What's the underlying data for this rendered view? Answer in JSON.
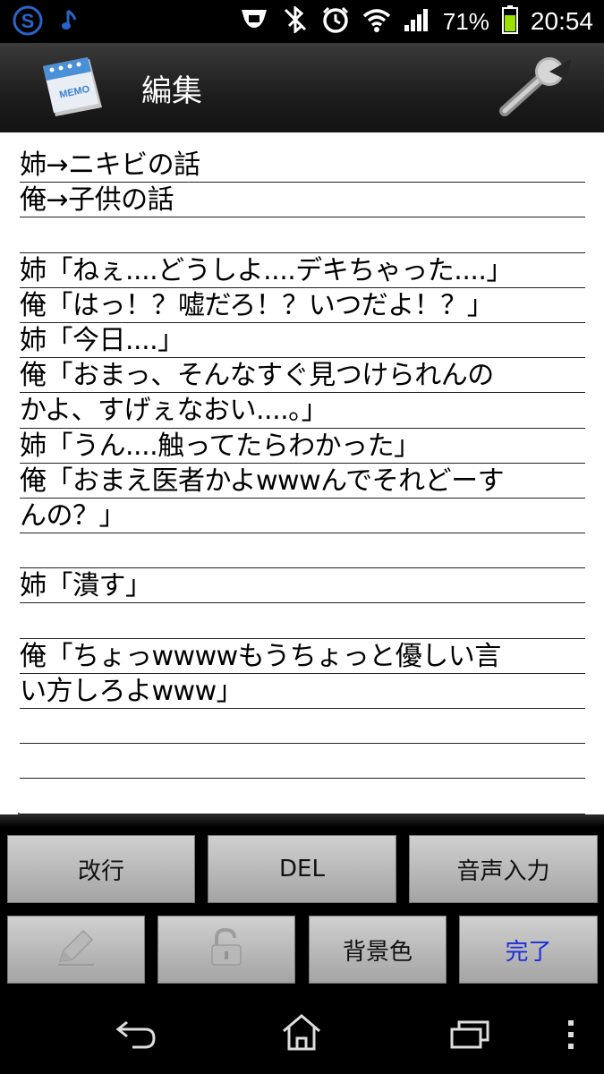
{
  "status_bar": {
    "battery_percent": "71%",
    "time": "20:54",
    "icons": [
      "s-app-icon",
      "music-note-icon",
      "mobile-data-icon",
      "bluetooth-off-icon",
      "alarm-icon",
      "wifi-icon",
      "signal-icon",
      "battery-icon"
    ]
  },
  "title_bar": {
    "title": "編集",
    "app_icon": "memo-icon",
    "app_icon_text": "MEMO",
    "settings_icon": "wrench-icon"
  },
  "memo": {
    "lines": [
      "姉→ニキビの話",
      "俺→子供の話",
      "",
      "姉「ねぇ....どうしよ....デキちゃった....」",
      "俺「はっ！？嘘だろ！？いつだよ！？」",
      "姉「今日....」",
      "俺「おまっ、そんなすぐ見つけられんの",
      "かよ、すげぇなおい....。」",
      "姉「うん....触ってたらわかった」",
      "俺「おまえ医者かよwwwんでそれどーす",
      "んの？」",
      "",
      "姉「潰す」",
      "",
      "俺「ちょっwwwwもうちょっと優しい言",
      "い方しろよwww」",
      "",
      "",
      ""
    ]
  },
  "buttons": {
    "newline": "改行",
    "del": "DEL",
    "voice_input": "音声入力",
    "pen_icon": "pen-icon",
    "lock_icon": "unlock-icon",
    "background_color": "背景色",
    "done": "完了"
  },
  "nav_bar": {
    "icons": [
      "back-icon",
      "home-icon",
      "recent-apps-icon",
      "menu-icon"
    ]
  },
  "colors": {
    "done_text": "#1a2ed6",
    "battery": "#9be000"
  }
}
